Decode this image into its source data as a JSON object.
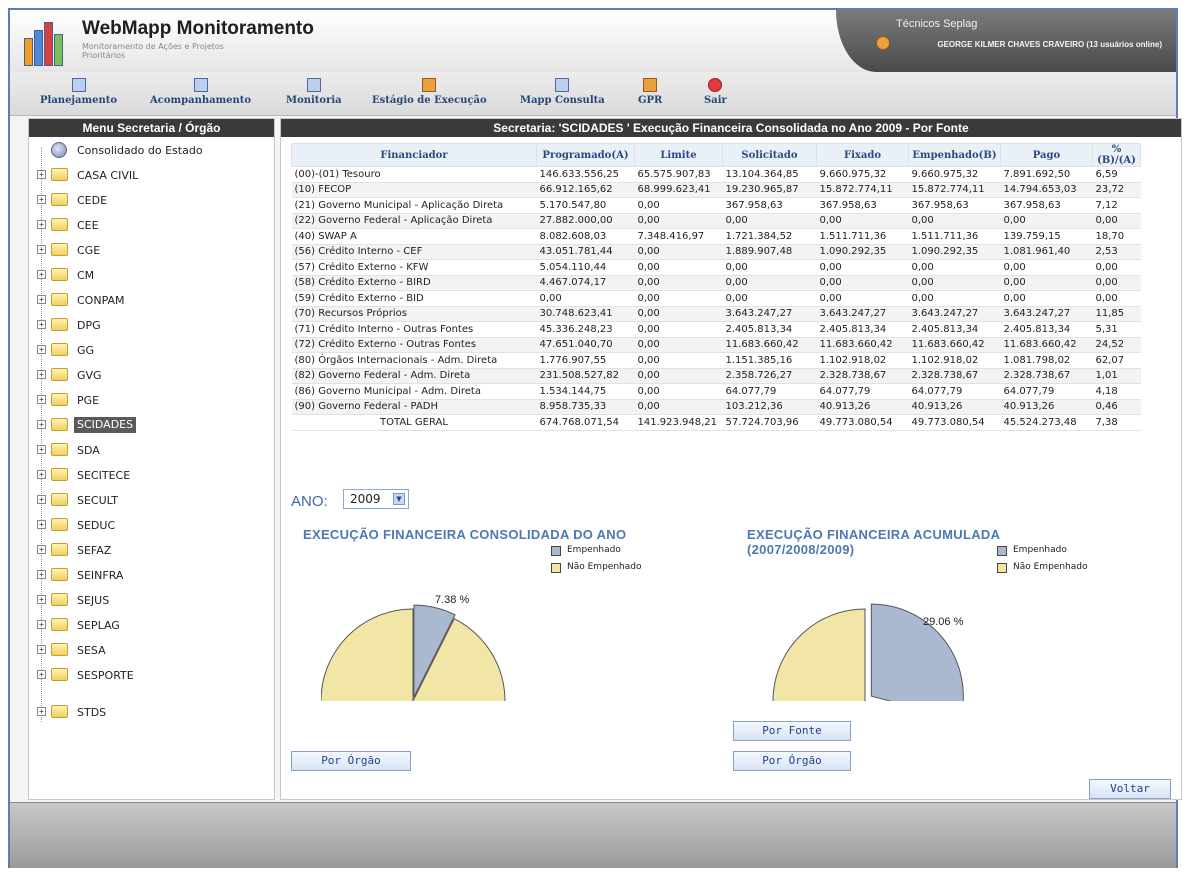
{
  "header": {
    "title": "WebMapp Monitoramento",
    "subtitle": "Monitoramento de Ações e Projetos Prioritários",
    "user_group": "Técnicos Seplag",
    "user_name": "GEORGE KILMER CHAVES CRAVEIRO (13 usuários online)"
  },
  "toolbar": {
    "items": [
      {
        "label": "Planejamento",
        "icon": "planning-icon"
      },
      {
        "label": "Acompanhamento",
        "icon": "tracking-icon"
      },
      {
        "label": "Monitoria",
        "icon": "monitoring-icon"
      },
      {
        "label": "Estágio de Execução",
        "icon": "execution-stage-icon"
      },
      {
        "label": "Mapp Consulta",
        "icon": "query-icon"
      },
      {
        "label": "GPR",
        "icon": "gpr-icon"
      },
      {
        "label": "Sair",
        "icon": "exit-icon"
      }
    ]
  },
  "sidebar": {
    "title": "Menu Secretaria / Órgão",
    "root": "Consolidado do Estado",
    "items": [
      "CASA CIVIL",
      "CEDE",
      "CEE",
      "CGE",
      "CM",
      "CONPAM",
      "DPG",
      "GG",
      "GVG",
      "PGE",
      "SCIDADES",
      "SDA",
      "SECITECE",
      "SECULT",
      "SEDUC",
      "SEFAZ",
      "SEINFRA",
      "SEJUS",
      "SEPLAG",
      "SESA",
      "SESPORTE",
      "STDS"
    ],
    "selected": "SCIDADES"
  },
  "main": {
    "title": "Secretaria: 'SCIDADES ' Execução Financeira Consolidada no Ano 2009 - Por Fonte",
    "columns": [
      "Financiador",
      "Programado(A)",
      "Limite",
      "Solicitado",
      "Fixado",
      "Empenhado(B)",
      "Pago",
      "%(B)/(A)"
    ],
    "rows": [
      [
        "(00)-(01) Tesouro",
        "146.633.556,25",
        "65.575.907,83",
        "13.104.364,85",
        "9.660.975,32",
        "9.660.975,32",
        "7.891.692,50",
        "6,59"
      ],
      [
        "(10) FECOP",
        "66.912.165,62",
        "68.999.623,41",
        "19.230.965,87",
        "15.872.774,11",
        "15.872.774,11",
        "14.794.653,03",
        "23,72"
      ],
      [
        "(21) Governo Municipal - Aplicação Direta",
        "5.170.547,80",
        "0,00",
        "367.958,63",
        "367.958,63",
        "367.958,63",
        "367.958,63",
        "7,12"
      ],
      [
        "(22) Governo Federal - Aplicação Direta",
        "27.882.000,00",
        "0,00",
        "0,00",
        "0,00",
        "0,00",
        "0,00",
        "0,00"
      ],
      [
        "(40) SWAP A",
        "8.082.608,03",
        "7.348.416,97",
        "1.721.384,52",
        "1.511.711,36",
        "1.511.711,36",
        "139.759,15",
        "18,70"
      ],
      [
        "(56) Crédito Interno - CEF",
        "43.051.781,44",
        "0,00",
        "1.889.907,48",
        "1.090.292,35",
        "1.090.292,35",
        "1.081.961,40",
        "2,53"
      ],
      [
        "(57) Crédito Externo - KFW",
        "5.054.110,44",
        "0,00",
        "0,00",
        "0,00",
        "0,00",
        "0,00",
        "0,00"
      ],
      [
        "(58) Crédito Externo - BIRD",
        "4.467.074,17",
        "0,00",
        "0,00",
        "0,00",
        "0,00",
        "0,00",
        "0,00"
      ],
      [
        "(59) Crédito Externo - BID",
        "0,00",
        "0,00",
        "0,00",
        "0,00",
        "0,00",
        "0,00",
        "0,00"
      ],
      [
        "(70) Recursos Próprios",
        "30.748.623,41",
        "0,00",
        "3.643.247,27",
        "3.643.247,27",
        "3.643.247,27",
        "3.643.247,27",
        "11,85"
      ],
      [
        "(71) Crédito Interno - Outras Fontes",
        "45.336.248,23",
        "0,00",
        "2.405.813,34",
        "2.405.813,34",
        "2.405.813,34",
        "2.405.813,34",
        "5,31"
      ],
      [
        "(72) Crédito Externo - Outras Fontes",
        "47.651.040,70",
        "0,00",
        "11.683.660,42",
        "11.683.660,42",
        "11.683.660,42",
        "11.683.660,42",
        "24,52"
      ],
      [
        "(80) Órgãos Internacionais - Adm. Direta",
        "1.776.907,55",
        "0,00",
        "1.151.385,16",
        "1.102.918,02",
        "1.102.918,02",
        "1.081.798,02",
        "62,07"
      ],
      [
        "(82) Governo Federal - Adm. Direta",
        "231.508.527,82",
        "0,00",
        "2.358.726,27",
        "2.328.738,67",
        "2.328.738,67",
        "2.328.738,67",
        "1,01"
      ],
      [
        "(86) Governo Municipal - Adm. Direta",
        "1.534.144,75",
        "0,00",
        "64.077,79",
        "64.077,79",
        "64.077,79",
        "64.077,79",
        "4,18"
      ],
      [
        "(90) Governo Federal - PADH",
        "8.958.735,33",
        "0,00",
        "103.212,36",
        "40.913,26",
        "40.913,26",
        "40.913,26",
        "0,46"
      ]
    ],
    "total": [
      "TOTAL GERAL",
      "674.768.071,54",
      "141.923.948,21",
      "57.724.703,96",
      "49.773.080,54",
      "49.773.080,54",
      "45.524.273,48",
      "7,38"
    ],
    "ano_label": "ANO:",
    "ano_value": "2009"
  },
  "chart_data": [
    {
      "type": "pie",
      "title": "EXECUÇÃO FINANCEIRA CONSOLIDADA DO ANO",
      "labels": [
        "Empenhado",
        "Não Empenhado"
      ],
      "values": [
        7.38,
        92.62
      ],
      "annotation": "7.38 %",
      "colors": [
        "#a9b9cf",
        "#f2e6a6"
      ]
    },
    {
      "type": "pie",
      "title": "EXECUÇÃO FINANCEIRA ACUMULADA (2007/2008/2009)",
      "labels": [
        "Empenhado",
        "Não Empenhado"
      ],
      "values": [
        29.06,
        70.94
      ],
      "annotation": "29.06 %",
      "colors": [
        "#a9b9cf",
        "#f2e6a6"
      ]
    }
  ],
  "buttons": {
    "por_orgao_left": "Por Órgão",
    "por_fonte": "Por Fonte",
    "por_orgao_right": "Por Órgão",
    "voltar": "Voltar"
  }
}
